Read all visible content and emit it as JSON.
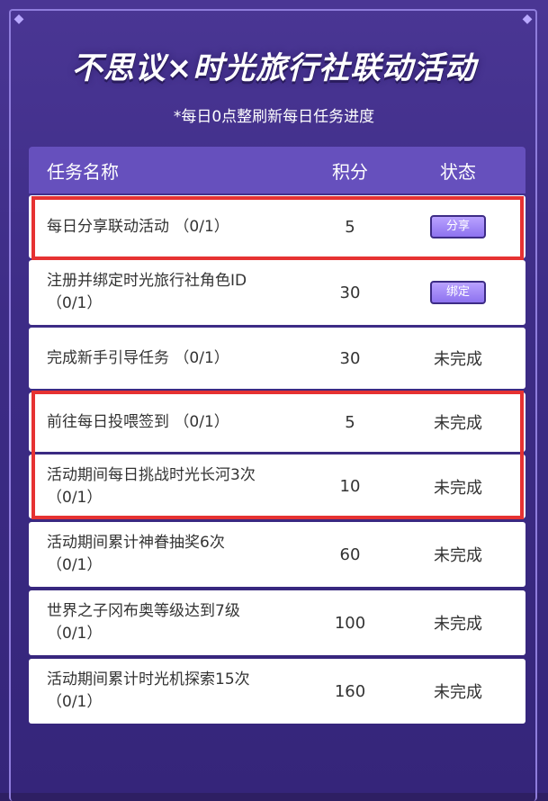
{
  "title": "不思议×时光旅行社联动活动",
  "subtitle": "*每日0点整刷新每日任务进度",
  "table": {
    "headers": {
      "name": "任务名称",
      "score": "积分",
      "status": "状态"
    },
    "rows": [
      {
        "name_line1": "每日分享联动活动 （0/1）",
        "name_line2": "",
        "score": "5",
        "status": "",
        "button": "分享"
      },
      {
        "name_line1": "注册并绑定时光旅行社角色ID",
        "name_line2": "（0/1）",
        "score": "30",
        "status": "",
        "button": "绑定"
      },
      {
        "name_line1": "完成新手引导任务 （0/1）",
        "name_line2": "",
        "score": "30",
        "status": "未完成",
        "button": ""
      },
      {
        "name_line1": "前往每日投喂签到 （0/1）",
        "name_line2": "",
        "score": "5",
        "status": "未完成",
        "button": ""
      },
      {
        "name_line1": "活动期间每日挑战时光长河3次",
        "name_line2": "（0/1）",
        "score": "10",
        "status": "未完成",
        "button": ""
      },
      {
        "name_line1": "活动期间累计神眷抽奖6次",
        "name_line2": "（0/1）",
        "score": "60",
        "status": "未完成",
        "button": ""
      },
      {
        "name_line1": "世界之子冈布奥等级达到7级",
        "name_line2": "（0/1）",
        "score": "100",
        "status": "未完成",
        "button": ""
      },
      {
        "name_line1": "活动期间累计时光机探索15次",
        "name_line2": "（0/1）",
        "score": "160",
        "status": "未完成",
        "button": ""
      }
    ]
  },
  "colors": {
    "background": "#3d2c86",
    "header": "#6650bd",
    "highlight": "#e63232",
    "button": "#a48bf8"
  }
}
